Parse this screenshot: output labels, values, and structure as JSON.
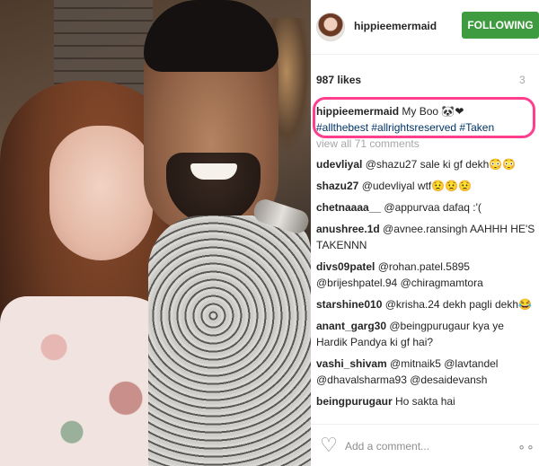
{
  "post": {
    "username": "hippieemermaid",
    "follow_label": "FOLLOWING",
    "likes": "987 likes",
    "time_ago": "3",
    "caption": {
      "username": "hippieemermaid",
      "text": " My Boo 🐼",
      "heart": "❤",
      "hashtags": "#allthebest #allrightsreserved #Taken"
    },
    "view_all": "view all 71 comments"
  },
  "comments": [
    {
      "user": "udevliyal",
      "text": " @shazu27 sale ki gf dekh😳😳"
    },
    {
      "user": "shazu27",
      "text": " @udevliyal wtf😟😟😟"
    },
    {
      "user": "chetnaaaa__",
      "text": " @appurvaa dafaq :'("
    },
    {
      "user": "anushree.1d",
      "text": " @avnee.ransingh AAHHH HE'S TAKENNN"
    },
    {
      "user": "divs09patel",
      "text": " @rohan.patel.5895 @brijeshpatel.94 @chiragmamtora"
    },
    {
      "user": "starshine010",
      "text": " @krisha.24 dekh pagli dekh😂"
    },
    {
      "user": "anant_garg30",
      "text": " @beingpurugaur kya ye Hardik Pandya ki gf hai?"
    },
    {
      "user": "vashi_shivam",
      "text": " @mitnaik5 @lavtandel @dhavalsharma93 @desaidevansh"
    },
    {
      "user": "beingpurugaur",
      "text": " Ho sakta hai"
    }
  ],
  "add_comment": {
    "placeholder": "Add a comment...",
    "heart_icon": "heart-outline-icon",
    "more_icon": "more-options-icon",
    "more_glyph": "∘∘"
  },
  "colors": {
    "follow_green": "#3f9b3f",
    "highlight_pink": "#ff3f8e",
    "hashtag_blue": "#003569"
  }
}
